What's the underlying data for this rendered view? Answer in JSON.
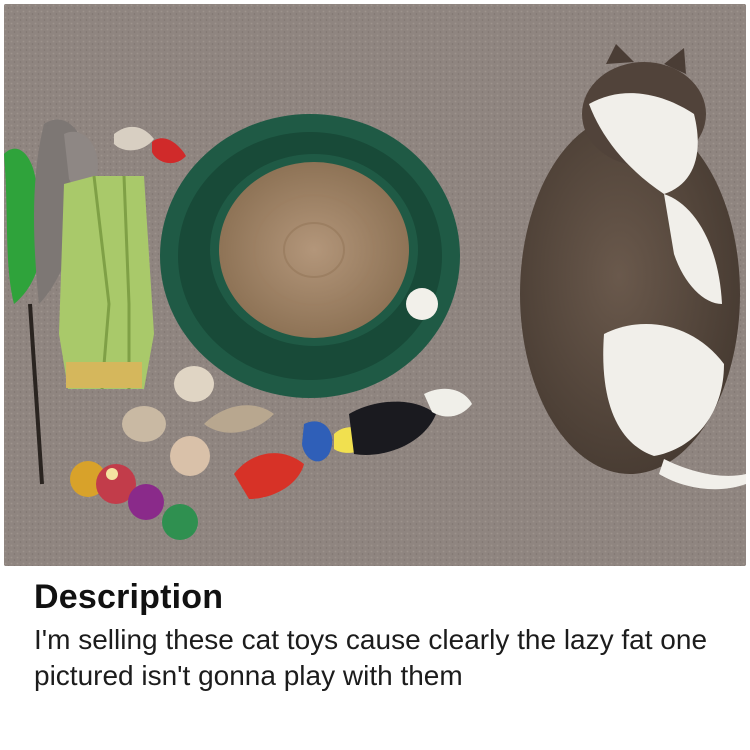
{
  "caption": {
    "title": "Description",
    "body": "I'm selling these cat toys cause clearly the lazy fat one pictured isn't gonna play with them"
  },
  "photo": {
    "subjects": [
      "feather-wand-toy",
      "corn-cob-toy",
      "scratcher-track-toy",
      "ball-toy",
      "plush-bird-toys",
      "crinkle-balls",
      "sleeping-cat"
    ],
    "colors": {
      "carpet": "#8f8580",
      "scratcher_ring": "#1f5a45",
      "cardboard": "#a68767",
      "cat_dark": "#5a4b40",
      "cat_white": "#f1efea",
      "feather_green": "#2fa33b",
      "corn_green": "#a9c96a"
    }
  }
}
